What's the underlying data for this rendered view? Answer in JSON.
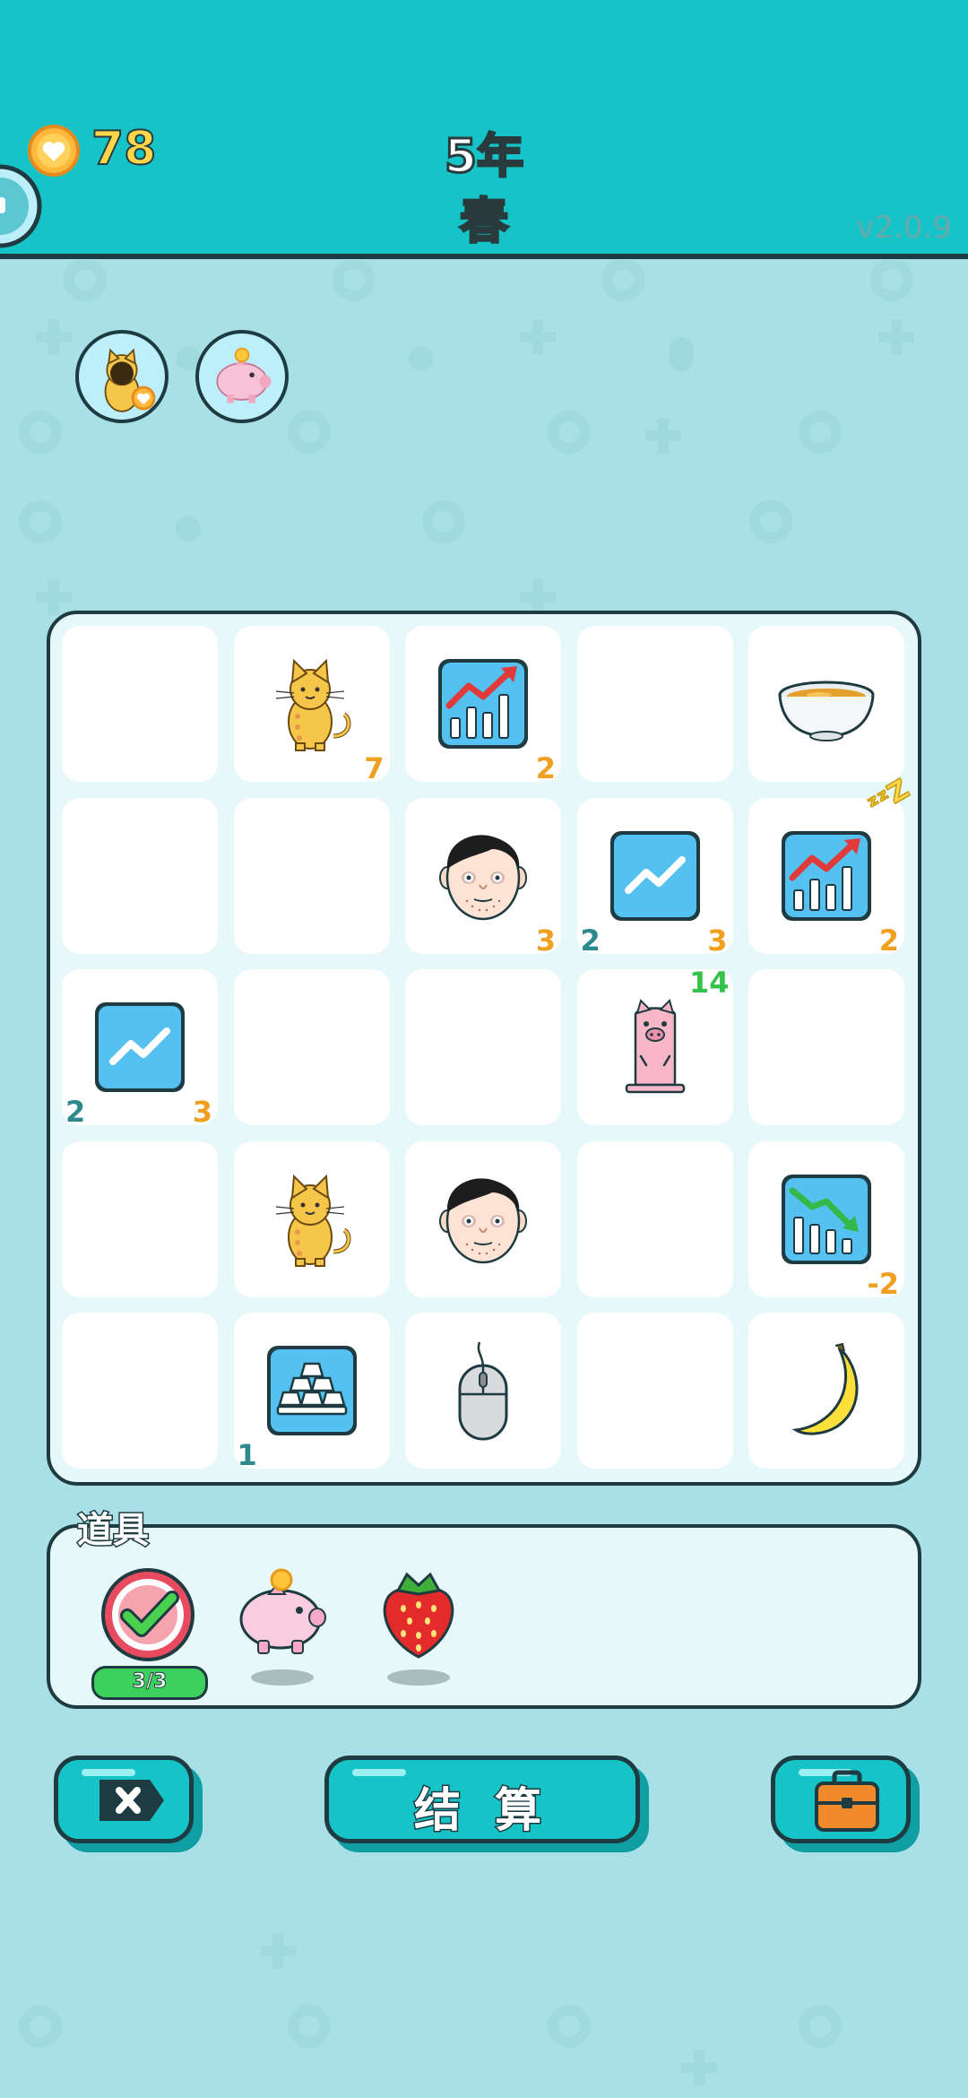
{
  "header": {
    "coins": "78",
    "year": "5年",
    "season": "春",
    "version": "v2.0.9",
    "coin_icon": "heart-coin-icon",
    "colors": {
      "header_bg": "#16c4c8",
      "season": "#5fe25b",
      "coin_text": "#ffd54a"
    }
  },
  "status_effects": [
    {
      "icon": "cat-with-coin-icon"
    },
    {
      "icon": "piggy-bank-icon"
    }
  ],
  "board": {
    "rows": 5,
    "cols": 5,
    "cells": [
      {
        "row": 0,
        "col": 0,
        "item": "empty"
      },
      {
        "row": 0,
        "col": 1,
        "item": "cat",
        "br": "7"
      },
      {
        "row": 0,
        "col": 2,
        "item": "stock-up-chart",
        "br": "2"
      },
      {
        "row": 0,
        "col": 3,
        "item": "empty"
      },
      {
        "row": 0,
        "col": 4,
        "item": "soup-bowl"
      },
      {
        "row": 1,
        "col": 0,
        "item": "empty"
      },
      {
        "row": 1,
        "col": 1,
        "item": "empty"
      },
      {
        "row": 1,
        "col": 2,
        "item": "man-face",
        "br": "3"
      },
      {
        "row": 1,
        "col": 3,
        "item": "trend-card",
        "bl": "2",
        "br": "3"
      },
      {
        "row": 1,
        "col": 4,
        "item": "stock-up-chart-sleeping",
        "br": "2"
      },
      {
        "row": 2,
        "col": 0,
        "item": "trend-card",
        "bl": "2",
        "br": "3"
      },
      {
        "row": 2,
        "col": 1,
        "item": "empty"
      },
      {
        "row": 2,
        "col": 2,
        "item": "empty"
      },
      {
        "row": 2,
        "col": 3,
        "item": "pig-statue",
        "tr": "14"
      },
      {
        "row": 2,
        "col": 4,
        "item": "empty"
      },
      {
        "row": 3,
        "col": 0,
        "item": "empty"
      },
      {
        "row": 3,
        "col": 1,
        "item": "cat"
      },
      {
        "row": 3,
        "col": 2,
        "item": "man-face"
      },
      {
        "row": 3,
        "col": 3,
        "item": "empty"
      },
      {
        "row": 3,
        "col": 4,
        "item": "stock-down-chart",
        "br": "-2"
      },
      {
        "row": 4,
        "col": 0,
        "item": "empty"
      },
      {
        "row": 4,
        "col": 1,
        "item": "gold-bars-card",
        "bl": "1"
      },
      {
        "row": 4,
        "col": 2,
        "item": "computer-mouse"
      },
      {
        "row": 4,
        "col": 3,
        "item": "empty"
      },
      {
        "row": 4,
        "col": 4,
        "item": "banana"
      }
    ]
  },
  "props": {
    "label": "道具",
    "items": [
      {
        "icon": "check-target-icon",
        "uses": "3/3"
      },
      {
        "icon": "piggy-bank-icon"
      },
      {
        "icon": "strawberry-icon"
      }
    ]
  },
  "buttons": {
    "skip_icon": "x-tag-icon",
    "settle_label": "结 算",
    "bag_icon": "briefcase-icon"
  }
}
